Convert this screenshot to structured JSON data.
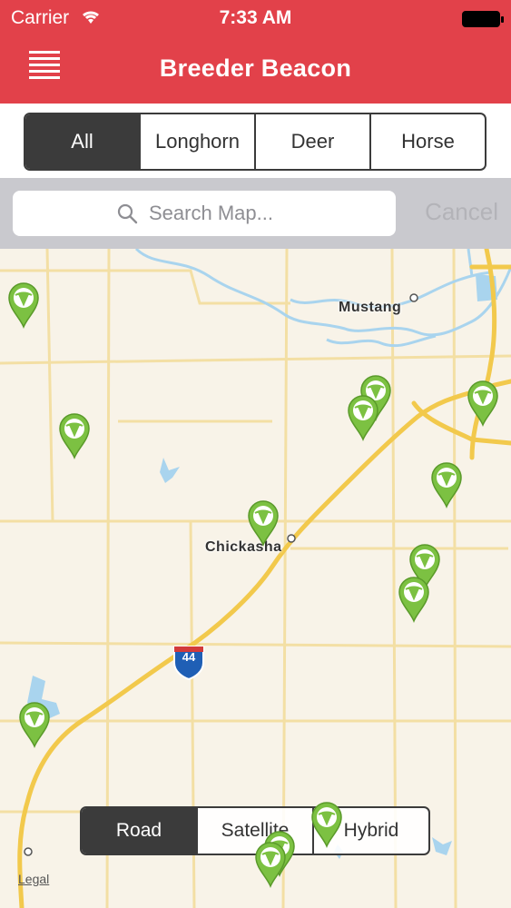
{
  "status": {
    "carrier": "Carrier",
    "time": "7:33 AM"
  },
  "nav": {
    "title": "Breeder Beacon",
    "menu_icon": "hamburger-menu-icon"
  },
  "filters": {
    "items": [
      "All",
      "Longhorn",
      "Deer",
      "Horse"
    ],
    "selected": "All"
  },
  "search": {
    "placeholder": "Search Map...",
    "value": "",
    "cancel_label": "Cancel"
  },
  "map": {
    "places": [
      "Mustang",
      "Chickasha"
    ],
    "highway_shield": "44",
    "legal_label": "Legal",
    "pin_icon": "longhorn-marker-icon",
    "pin_color": "#7cc142",
    "map_types": [
      "Road",
      "Satellite",
      "Hybrid"
    ],
    "selected_map_type": "Road"
  },
  "colors": {
    "brand": "#e2414a",
    "segment_dark": "#3b3b3b",
    "map_background": "#f8f3e8",
    "road_yellow": "#f2c94c",
    "water_blue": "#a9d4ee"
  }
}
